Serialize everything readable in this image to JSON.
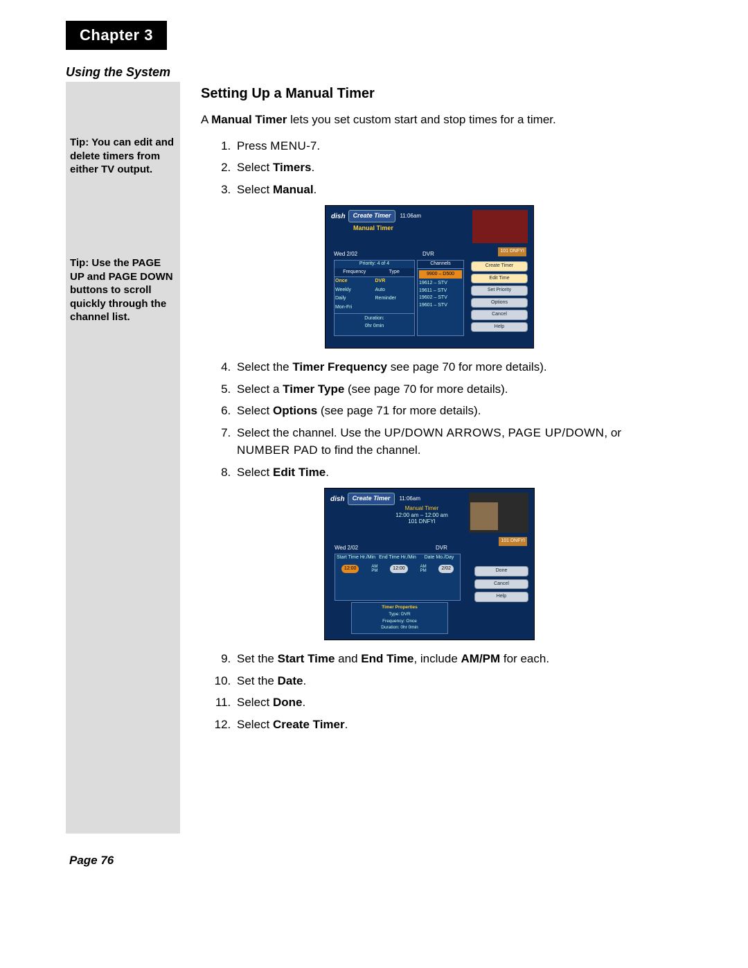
{
  "chapter": "Chapter 3",
  "section": "Using the System",
  "heading": "Setting Up a Manual Timer",
  "intro_pre": "A ",
  "intro_bold": "Manual Timer",
  "intro_post": " lets you set custom start and stop times for a timer.",
  "tips": {
    "tip1": "Tip: You can edit and delete timers from either TV output.",
    "tip2": "Tip: Use the PAGE UP and PAGE DOWN buttons to scroll quickly through the channel list."
  },
  "steps": {
    "s1_pre": "Press ",
    "s1_sc": "MENU",
    "s1_post": "-7.",
    "s2_pre": "Select ",
    "s2_b": "Timers",
    "s2_post": ".",
    "s3_pre": "Select ",
    "s3_b": "Manual",
    "s3_post": ".",
    "s4_pre": "Select the ",
    "s4_b": "Timer Frequency",
    "s4_post": " see page 70 for more details).",
    "s5_pre": "Select a ",
    "s5_b": "Timer Type",
    "s5_post": " (see page 70 for more details).",
    "s6_pre": "Select ",
    "s6_b": "Options",
    "s6_post": " (see page 71 for more details).",
    "s7_pre": "Select the channel. Use the ",
    "s7_sc1": "UP/DOWN ARROWS",
    "s7_mid1": ", ",
    "s7_sc2": "PAGE UP/DOWN",
    "s7_mid2": ", or ",
    "s7_sc3": "NUMBER PAD",
    "s7_post": " to find the channel.",
    "s8_pre": "Select ",
    "s8_b": "Edit Time",
    "s8_post": ".",
    "s9_pre": "Set the ",
    "s9_b1": "Start Time",
    "s9_mid1": " and ",
    "s9_b2": "End Time",
    "s9_mid2": ", include ",
    "s9_b3": "AM/PM",
    "s9_post": " for each.",
    "s10_pre": "Set the ",
    "s10_b": "Date",
    "s10_post": ".",
    "s11_pre": "Select ",
    "s11_b": "Done",
    "s11_post": ".",
    "s12_pre": "Select ",
    "s12_b": "Create Timer",
    "s12_post": "."
  },
  "page_label": "Page 76",
  "screenshot1": {
    "logo": "dish",
    "title": "Create Timer",
    "time": "11:06am",
    "subtitle": "Manual Timer",
    "preview_channel": "101 DNFYI",
    "date": "Wed 2/02",
    "dvr": "DVR",
    "priority": "Priority: 4 of 4",
    "col_freq": "Frequency",
    "col_type": "Type",
    "freq": [
      "Once",
      "Weekly",
      "Daily",
      "Mon-Fri"
    ],
    "type": [
      "DVR",
      "Auto",
      "Reminder"
    ],
    "duration_lbl": "Duration:",
    "duration_val": "0hr 0min",
    "channels_header": "Channels",
    "channels_selected": "9900 – D500",
    "channels": [
      "19612 – STV",
      "19611 – STV",
      "19602 – STV",
      "19601 – STV"
    ],
    "buttons": [
      "Create Timer",
      "Edit Time",
      "Set Priority",
      "Options",
      "Cancel",
      "Help"
    ]
  },
  "screenshot2": {
    "logo": "dish",
    "title": "Create Timer",
    "time": "11:06am",
    "subtitle_l1": "Manual Timer",
    "subtitle_l2": "12:00 am – 12:00 am",
    "subtitle_l3": "101 DNFYI",
    "preview_channel": "101 DNFYI",
    "date": "Wed 2/02",
    "dvr": "DVR",
    "col_start": "Start Time Hr./Min",
    "col_end": "End Time Hr./Min",
    "col_date": "Date Mo./Day",
    "val_start": "12:00",
    "val_end": "12:00",
    "val_date": "2/02",
    "am": "AM",
    "pm": "PM",
    "props_title": "Timer Properties",
    "props_type": "Type: DVR",
    "props_freq": "Frequency: Once",
    "props_dur": "Duration: 0hr 0min",
    "buttons": [
      "Done",
      "Cancel",
      "Help"
    ]
  }
}
